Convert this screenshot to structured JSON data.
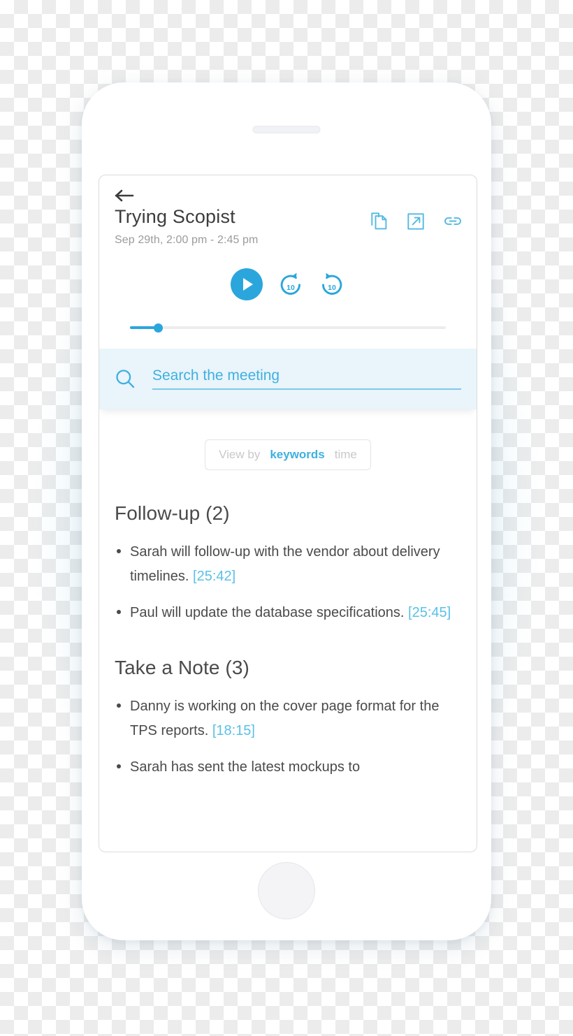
{
  "device": {
    "speaker_name": "phone-speaker",
    "home_button_name": "phone-home-button"
  },
  "colors": {
    "accent": "#2ba6dd",
    "accent_light": "#3fb0e0",
    "timestamp": "#5bc0e8",
    "search_band_bg": "#e9f4fb",
    "text": "#4a4a4a",
    "muted": "#9b9b9b"
  },
  "header": {
    "back_icon": "back-arrow-icon",
    "title": "Trying Scopist",
    "date_range": "Sep 29th, 2:00 pm - 2:45 pm",
    "actions": [
      {
        "name": "copy-icon",
        "label": "Copy"
      },
      {
        "name": "share-external-icon",
        "label": "Open externally"
      },
      {
        "name": "link-icon",
        "label": "Copy link"
      }
    ]
  },
  "player": {
    "play_label": "Play",
    "rewind_label": "10",
    "forward_label": "10",
    "progress_percent": 9
  },
  "search": {
    "icon": "search-icon",
    "value": "",
    "placeholder": "Search the meeting"
  },
  "view_by": {
    "label": "View by",
    "options": [
      {
        "id": "keywords",
        "label": "keywords",
        "selected": true
      },
      {
        "id": "time",
        "label": "time",
        "selected": false
      }
    ]
  },
  "sections": [
    {
      "title": "Follow-up (2)",
      "items": [
        {
          "text": "Sarah will follow-up with the vendor about delivery timelines.",
          "timestamp": "[25:42]"
        },
        {
          "text": "Paul will update the database specifications.",
          "timestamp": "[25:45]"
        }
      ]
    },
    {
      "title": "Take a Note (3)",
      "items": [
        {
          "text": "Danny is working on the cover page format for the TPS reports.",
          "timestamp": "[18:15]"
        },
        {
          "text": "Sarah has sent the latest mockups to",
          "timestamp": ""
        }
      ]
    }
  ]
}
